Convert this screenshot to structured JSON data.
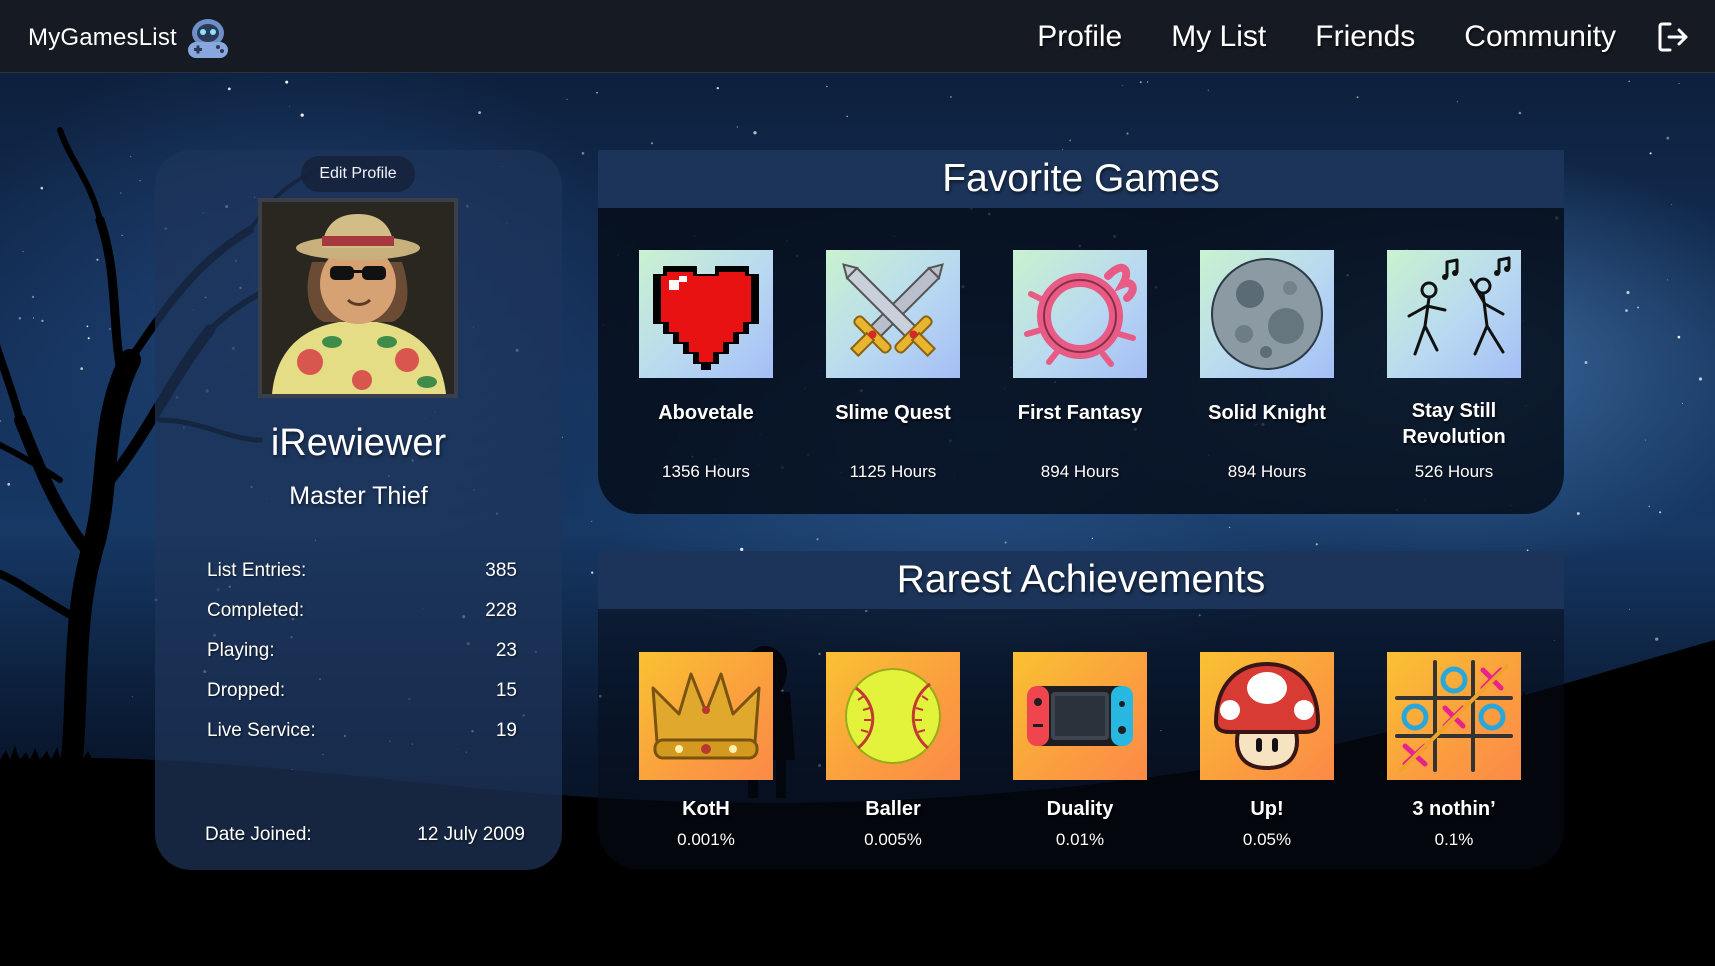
{
  "brand": {
    "name": "MyGamesList",
    "logo": "gamepad-logo-icon"
  },
  "nav": {
    "items": [
      {
        "label": "Profile"
      },
      {
        "label": "My List"
      },
      {
        "label": "Friends"
      },
      {
        "label": "Community"
      }
    ],
    "logout_icon": "logout-icon"
  },
  "profile": {
    "edit_label": "Edit Profile",
    "username": "iRewiewer",
    "title": "Master Thief",
    "stats": [
      {
        "label": "List Entries:",
        "value": "385"
      },
      {
        "label": "Completed:",
        "value": "228"
      },
      {
        "label": "Playing:",
        "value": "23"
      },
      {
        "label": "Dropped:",
        "value": "15"
      },
      {
        "label": "Live Service:",
        "value": "19"
      }
    ],
    "joined_label": "Date Joined:",
    "joined_value": "12 July 2009"
  },
  "favorites": {
    "heading": "Favorite Games",
    "games": [
      {
        "name": "Abovetale",
        "hours": "1356 Hours",
        "icon": "pixel-heart-icon"
      },
      {
        "name": "Slime Quest",
        "hours": "1125 Hours",
        "icon": "crossed-swords-icon"
      },
      {
        "name": "First Fantasy",
        "hours": "894 Hours",
        "icon": "fire-ring-icon"
      },
      {
        "name": "Solid Knight",
        "hours": "894 Hours",
        "icon": "moon-icon"
      },
      {
        "name": "Stay Still Revolution",
        "hours": "526 Hours",
        "icon": "dancers-icon"
      }
    ]
  },
  "achievements": {
    "heading": "Rarest Achievements",
    "items": [
      {
        "name": "KotH",
        "percent": "0.001%",
        "icon": "crown-icon"
      },
      {
        "name": "Baller",
        "percent": "0.005%",
        "icon": "softball-icon"
      },
      {
        "name": "Duality",
        "percent": "0.01%",
        "icon": "handheld-console-icon"
      },
      {
        "name": "Up!",
        "percent": "0.05%",
        "icon": "mushroom-icon"
      },
      {
        "name": "3 nothin’",
        "percent": "0.1%",
        "icon": "tic-tac-toe-icon"
      }
    ]
  },
  "colors": {
    "topbar": "#161a22",
    "panel_header": "#1c3459",
    "profile_card": "#1e345a"
  }
}
